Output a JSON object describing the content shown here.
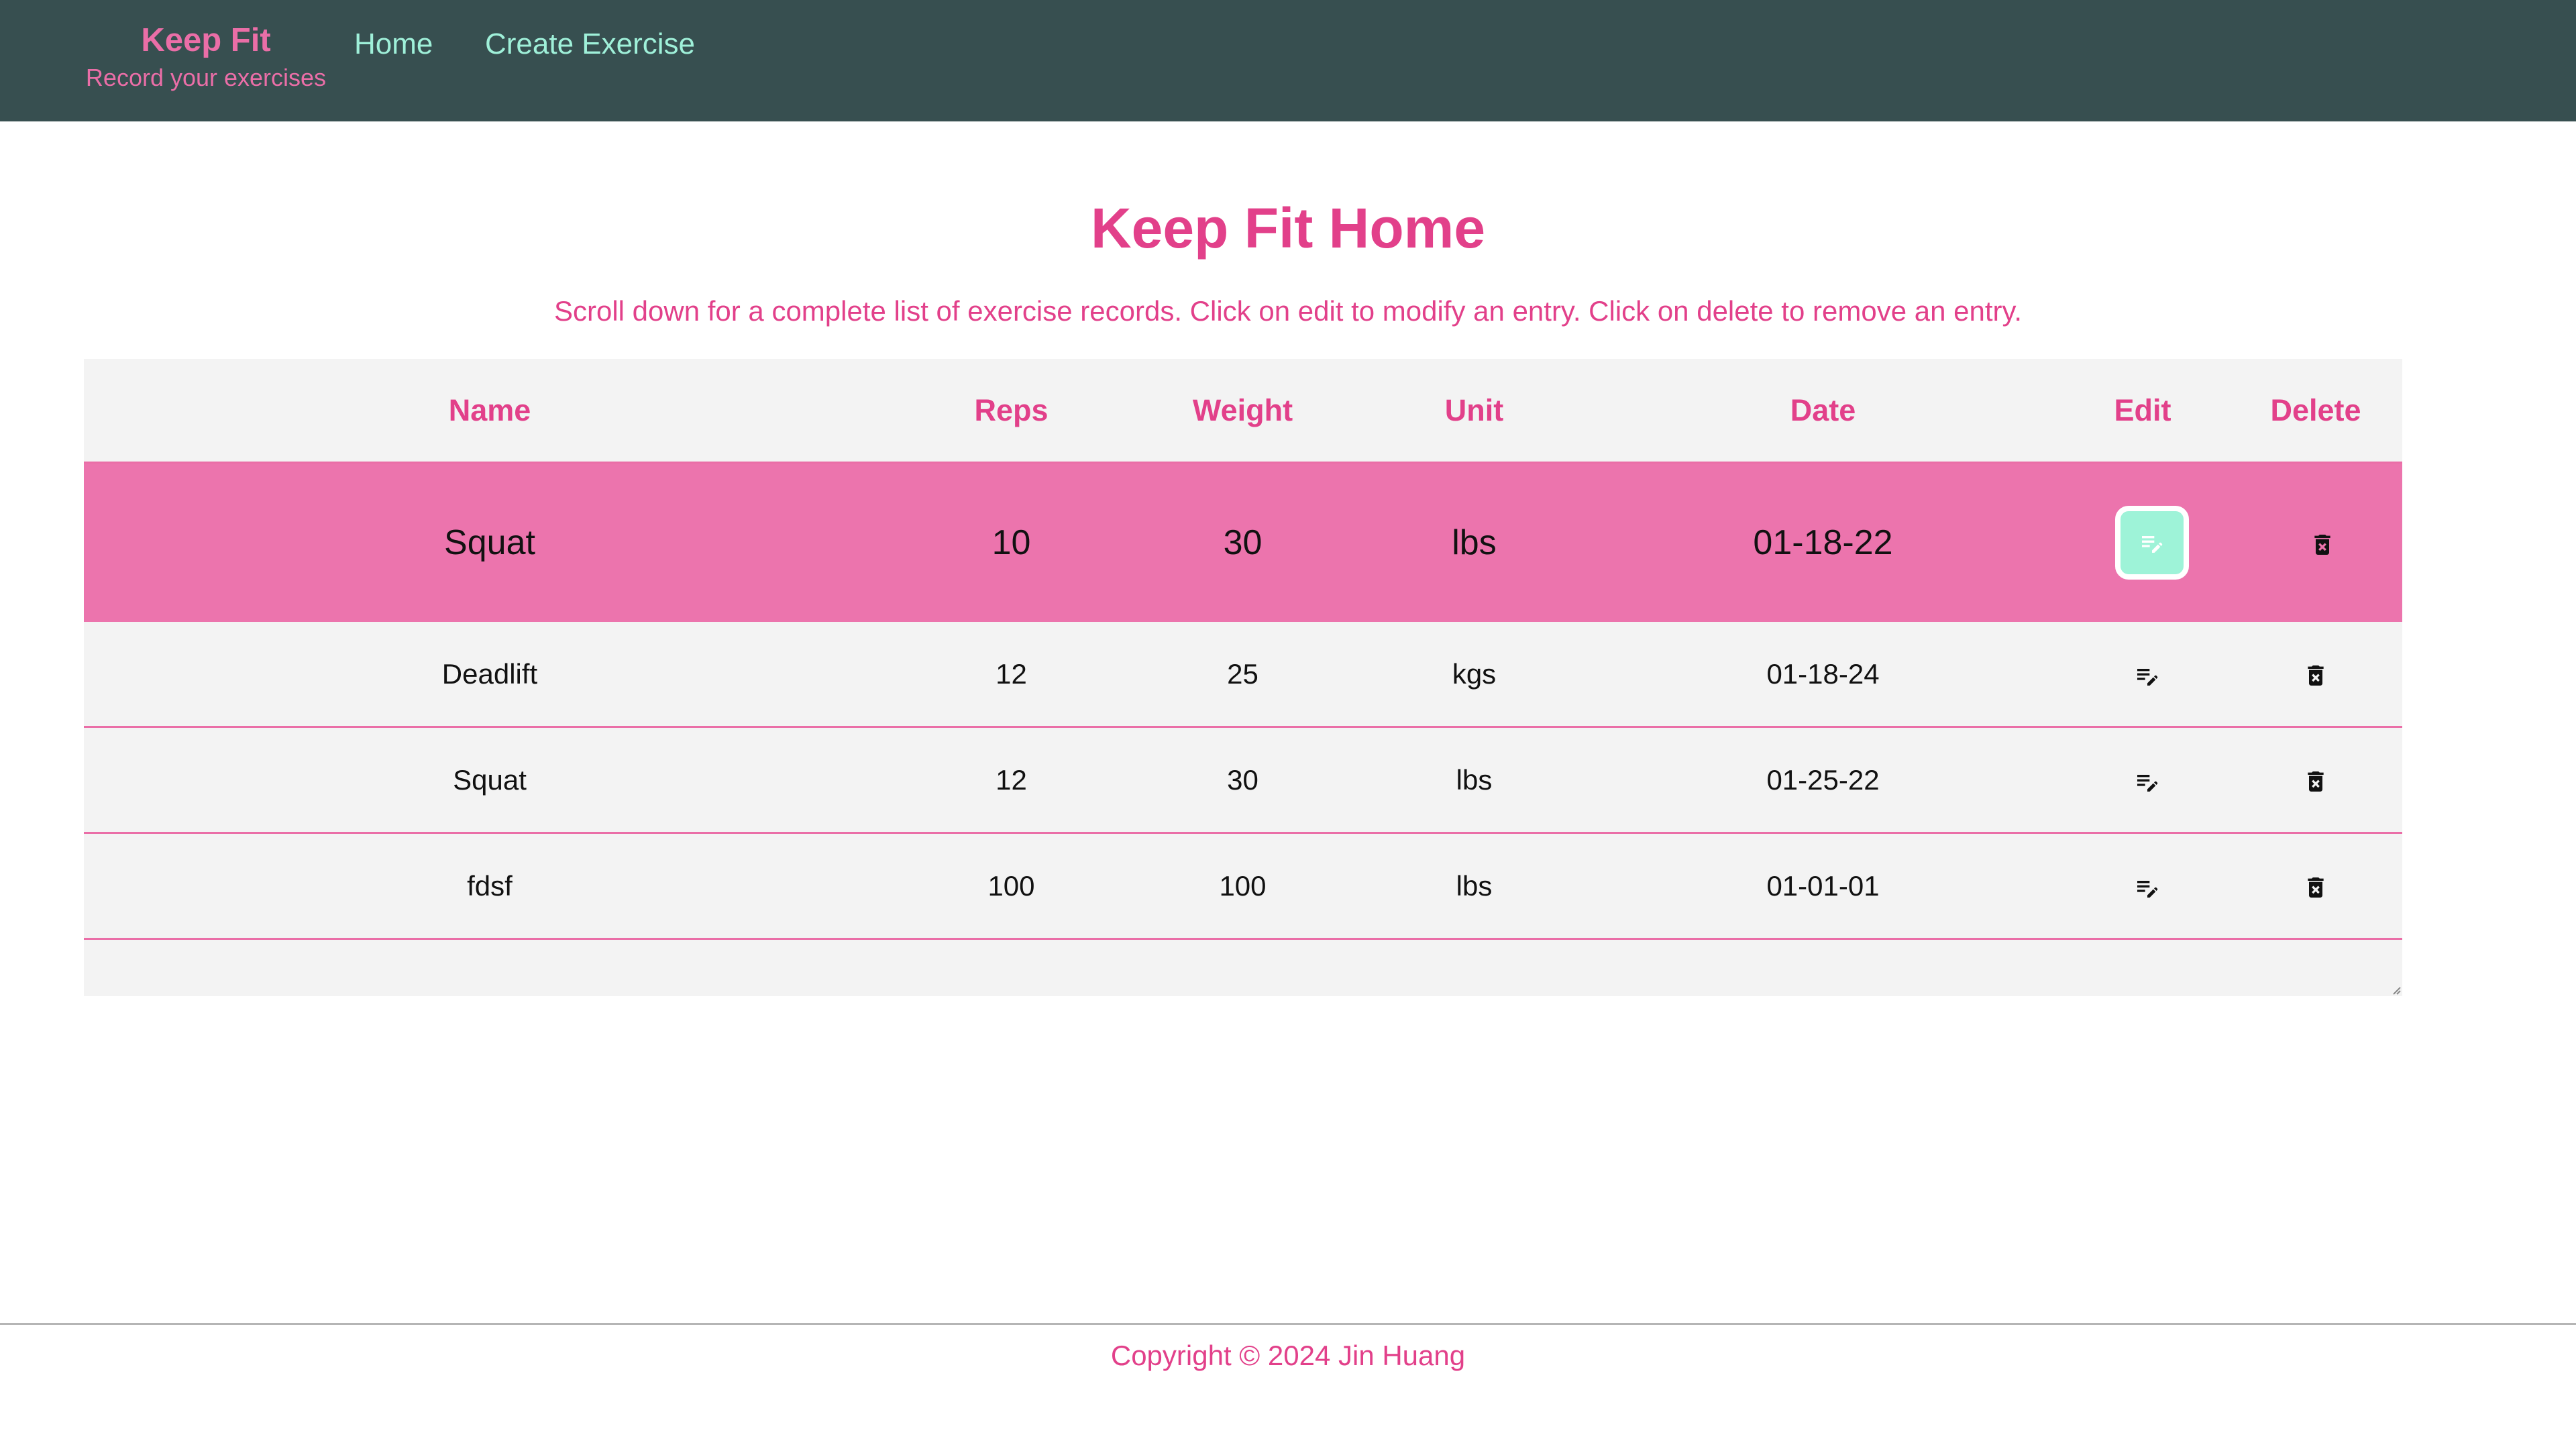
{
  "nav": {
    "brand_title": "Keep Fit",
    "brand_subtitle": "Record your exercises",
    "links": [
      "Home",
      "Create Exercise"
    ]
  },
  "main": {
    "heading": "Keep Fit Home",
    "description": "Scroll down for a complete list of exercise records. Click on edit to modify an entry. Click on delete to remove an entry.",
    "table": {
      "headers": [
        "Name",
        "Reps",
        "Weight",
        "Unit",
        "Date",
        "Edit",
        "Delete"
      ],
      "rows": [
        {
          "name": "Squat",
          "reps": "10",
          "weight": "30",
          "unit": "lbs",
          "date": "01-18-22"
        },
        {
          "name": "Deadlift",
          "reps": "12",
          "weight": "25",
          "unit": "kgs",
          "date": "01-18-24"
        },
        {
          "name": "Squat",
          "reps": "12",
          "weight": "30",
          "unit": "lbs",
          "date": "01-25-22"
        },
        {
          "name": "fdsf",
          "reps": "100",
          "weight": "100",
          "unit": "lbs",
          "date": "01-01-01"
        }
      ]
    }
  },
  "footer": {
    "copyright": "Copyright © 2024 Jin Huang"
  },
  "icons": {
    "edit": "edit-note-icon",
    "delete": "delete-forever-icon"
  },
  "colors": {
    "nav_bg": "#374f50",
    "accent_pink": "#e2408a",
    "highlight_row": "#ec74ad",
    "nav_link": "#9ff0d9",
    "edit_focus": "#9ef3d8"
  }
}
